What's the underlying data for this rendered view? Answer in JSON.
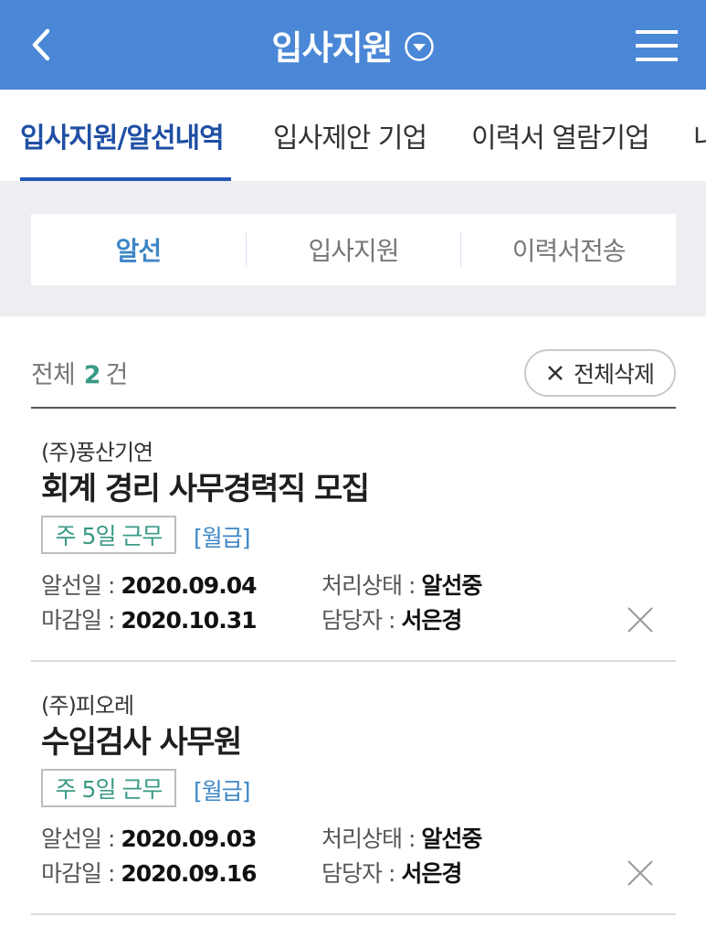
{
  "header": {
    "title": "입사지원",
    "background_color": "#4a87d6",
    "back_icon": "chevron-left-icon",
    "dropdown_icon": "chevron-down-circle-icon",
    "menu_icon": "hamburger-menu-icon"
  },
  "tabs": [
    {
      "label": "입사지원/알선내역",
      "active": true
    },
    {
      "label": "입사제안 기업",
      "active": false
    },
    {
      "label": "이력서 열람기업",
      "active": false
    },
    {
      "label": "내",
      "active": false
    }
  ],
  "segments": [
    {
      "label": "알선",
      "active": true
    },
    {
      "label": "입사지원",
      "active": false
    },
    {
      "label": "이력서전송",
      "active": false
    }
  ],
  "summary": {
    "total_label": "전체",
    "count": "2",
    "unit": "건",
    "delete_all_label": "전체삭제"
  },
  "jobs": [
    {
      "company": "(주)풍산기연",
      "title": "회계 경리 사무경력직 모집",
      "tag": "주 5일 근무",
      "pay": "[월급]",
      "referral_date_label": "알선일 :",
      "referral_date": "2020.09.04",
      "status_label": "처리상태 :",
      "status": "알선중",
      "deadline_label": "마감일 :",
      "deadline": "2020.10.31",
      "manager_label": "담당자 :",
      "manager": "서은경"
    },
    {
      "company": "(주)피오레",
      "title": "수입검사 사무원",
      "tag": "주 5일 근무",
      "pay": "[월급]",
      "referral_date_label": "알선일 :",
      "referral_date": "2020.09.03",
      "status_label": "처리상태 :",
      "status": "알선중",
      "deadline_label": "마감일 :",
      "deadline": "2020.09.16",
      "manager_label": "담당자 :",
      "manager": "서은경"
    }
  ],
  "colors": {
    "active_tab": "#1f4fa3",
    "active_segment": "#3d86c6",
    "count_accent": "#3a9a86",
    "tag_text": "#3a9a86",
    "pay_text": "#3d86c6"
  }
}
